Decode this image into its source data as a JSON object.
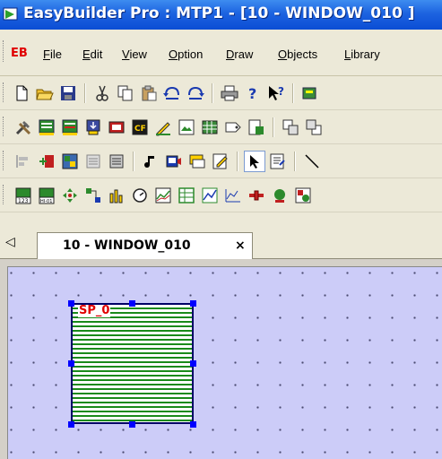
{
  "title": "EasyBuilder Pro : MTP1 - [10 - WINDOW_010 ]",
  "menu": {
    "logo": "EB",
    "items": [
      {
        "label": "File",
        "ul": "F",
        "rest": "ile"
      },
      {
        "label": "Edit",
        "ul": "E",
        "rest": "dit"
      },
      {
        "label": "View",
        "ul": "V",
        "rest": "iew"
      },
      {
        "label": "Option",
        "ul": "O",
        "rest": "ption"
      },
      {
        "label": "Draw",
        "ul": "D",
        "rest": "raw"
      },
      {
        "label": "Objects",
        "ul": "O",
        "rest": "bjects"
      },
      {
        "label": "Library",
        "ul": "L",
        "rest": "ibrary"
      }
    ]
  },
  "tab": {
    "arrow": "◁",
    "label": "10 - WINDOW_010",
    "close": "×"
  },
  "canvas": {
    "object_label": "SP_0"
  },
  "colors": {
    "title_bar": "#1d63e0",
    "canvas_bg": "#ccccf8",
    "object_lines": "#1a8a1a",
    "handle": "#0000ff",
    "object_label": "#e00000"
  }
}
